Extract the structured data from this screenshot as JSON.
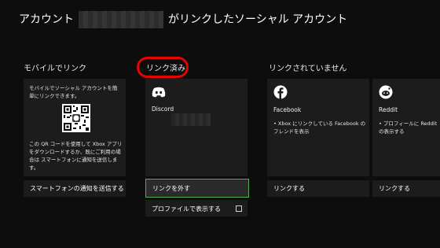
{
  "header": {
    "title_prefix": "アカウント",
    "title_suffix": "がリンクしたソーシャル アカウント"
  },
  "mobile": {
    "heading": "モバイルでリンク",
    "description": "モバイルでソーシャル アカウントを簡単にリンクできます。",
    "instructions": "この QR コードを使用して Xbox アプリをダウンロードするか、既にご利用の場合は スマートフォンに通知を送信します。",
    "send_button": "スマートフォンの通知を送信する"
  },
  "linked": {
    "heading": "リンク済み",
    "services": [
      {
        "name": "Discord",
        "icon": "discord-icon"
      }
    ],
    "unlink_button": "リンクを外す",
    "show_profile_label": "プロファイルで表示する"
  },
  "unlinked": {
    "heading": "リンクされていません",
    "services": [
      {
        "name": "Facebook",
        "icon": "facebook-icon",
        "description": "• Xbox にリンクしている Facebook のフレンドを表示",
        "button": "リンクする"
      },
      {
        "name": "Reddit",
        "icon": "reddit-icon",
        "description": "• プロフィールに Reddit の表示する",
        "button": "リンクする"
      }
    ]
  },
  "colors": {
    "focus_border": "#4caf50",
    "annotation_ring": "#e10600",
    "background": "#0d0d0d",
    "card": "#1c1c1c"
  }
}
